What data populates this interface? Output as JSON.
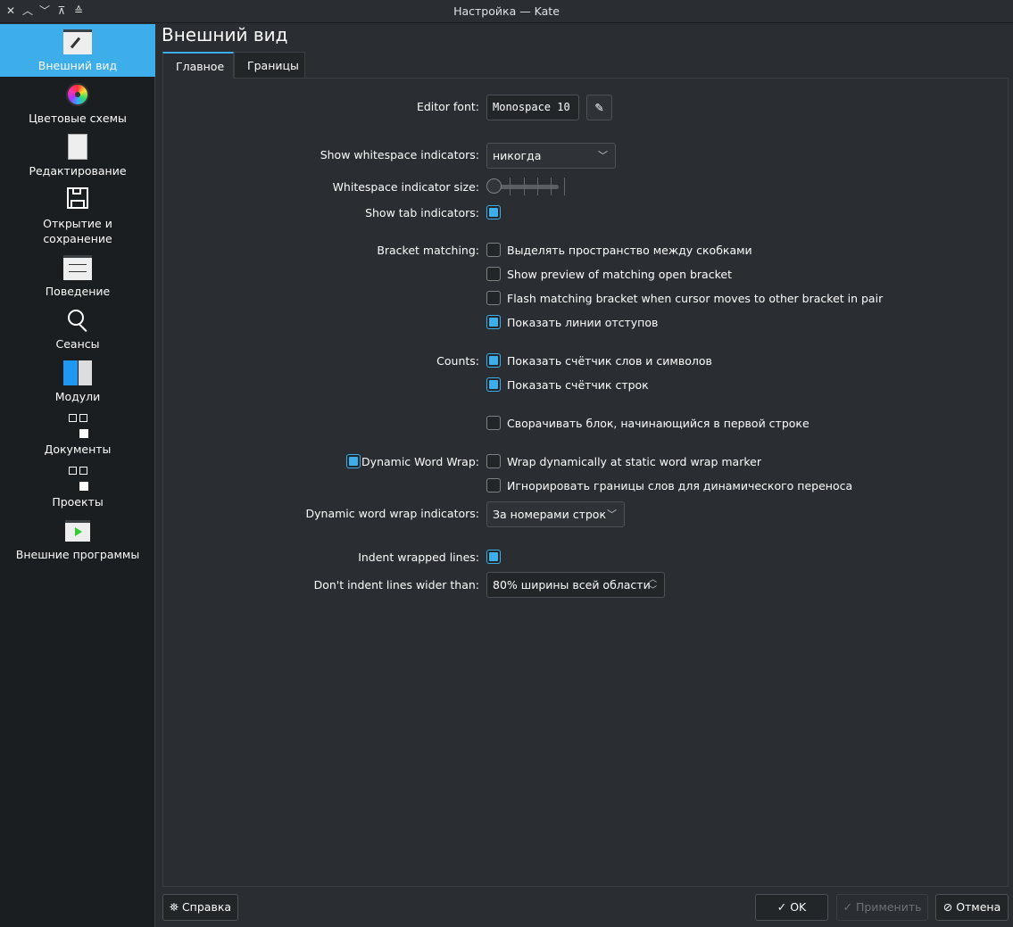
{
  "window": {
    "title": "Настройка — Kate"
  },
  "sidebar": {
    "items": [
      {
        "label": "Внешний вид",
        "icon": "appearance-icon",
        "selected": true
      },
      {
        "label": "Цветовые схемы",
        "icon": "color-wheel-icon"
      },
      {
        "label": "Редактирование",
        "icon": "document-edit-icon"
      },
      {
        "label": "Открытие и\nсохранение",
        "label1": "Открытие и",
        "label2": "сохранение",
        "icon": "save-icon"
      },
      {
        "label": "Поведение",
        "icon": "behavior-icon"
      },
      {
        "label": "Сеансы",
        "icon": "search-icon"
      },
      {
        "label": "Модули",
        "icon": "plugins-icon"
      },
      {
        "label": "Документы",
        "icon": "documents-tree-icon"
      },
      {
        "label": "Проекты",
        "icon": "projects-tree-icon"
      },
      {
        "label": "Внешние программы",
        "icon": "external-tools-icon"
      }
    ]
  },
  "page": {
    "title": "Внешний вид",
    "tabs": [
      "Главное",
      "Границы"
    ]
  },
  "form": {
    "editor_font_label": "Editor font:",
    "editor_font_value": "Monospace 10",
    "whitespace_label": "Show whitespace indicators:",
    "whitespace_value": "никогда",
    "ws_size_label": "Whitespace indicator size:",
    "ws_size_value": 0,
    "tab_ind_label": "Show tab indicators:",
    "tab_ind_checked": true,
    "bracket_label": "Bracket matching:",
    "bracket_options": [
      {
        "text": "Выделять пространство между скобками",
        "checked": false
      },
      {
        "text": "Show preview of matching open bracket",
        "checked": false
      },
      {
        "text": "Flash matching bracket when cursor moves to other bracket in pair",
        "checked": false
      },
      {
        "text": "Показать линии отступов",
        "checked": true
      }
    ],
    "counts_label": "Counts:",
    "counts_options": [
      {
        "text": "Показать счётчик слов и символов",
        "checked": true
      },
      {
        "text": "Показать счётчик строк",
        "checked": true
      }
    ],
    "fold_text": "Сворачивать блок, начинающийся в первой строке",
    "dww_label": "Dynamic Word Wrap:",
    "dww_options": [
      {
        "text": "Wrap dynamically at static word wrap marker",
        "checked": false
      },
      {
        "text": "Игнорировать границы слов для динамического переноса",
        "checked": false
      }
    ],
    "dww_ind_label": "Dynamic word wrap indicators:",
    "dww_ind_value": "За номерами строк",
    "indent_label": "Indent wrapped lines:",
    "noindent_label": "Don't indent lines wider than:",
    "noindent_value": "80% ширины всей области"
  },
  "buttons": {
    "help": "Справка",
    "ok": "OK",
    "apply": "Применить",
    "cancel": "Отмена"
  }
}
